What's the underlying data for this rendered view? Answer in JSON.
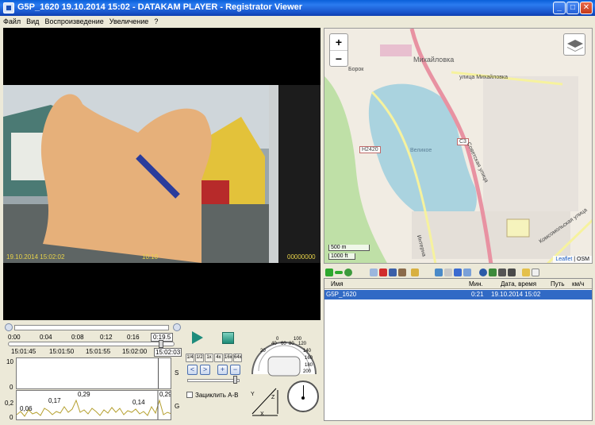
{
  "window": {
    "title": "G5P_1620    19.10.2014 15:02  -  DATAKAM PLAYER - Registrator Viewer"
  },
  "menu": [
    "Файл",
    "Вид",
    "Воспроизведение",
    "Увеличение",
    "?"
  ],
  "video": {
    "osd_left": "19.10.2014 15:02:02",
    "osd_mid": "10.10",
    "osd_right": "00000000"
  },
  "map": {
    "zoom_in": "+",
    "zoom_out": "−",
    "labels": {
      "town": "Михайловка",
      "village": "Борок",
      "street1": "улица Михайловка",
      "road_badge": "Н2420",
      "road_badge2": "С3",
      "lake": "Великое",
      "street2": "Советская улица",
      "street3": "Комсомольская улица",
      "street4": "Интерна"
    },
    "scale_m": "500 m",
    "scale_ft": "1000 ft",
    "attribution_link": "Leaflet",
    "attribution_sep": " | OSM"
  },
  "trips": {
    "columns": {
      "name": "Имя",
      "min": "Мин.",
      "datetime": "Дата, время",
      "path": "Путь",
      "speed": "км/ч"
    },
    "rows": [
      {
        "name": "G5P_1620",
        "min": "0:21",
        "datetime": "19.10.2014 15:02"
      }
    ]
  },
  "timeline": {
    "scale_ticks": [
      "0:00",
      "0:04",
      "0:08",
      "0:12",
      "0:16"
    ],
    "current": "0:19.5",
    "clock_ticks": [
      "15:01:45",
      "15:01:50",
      "15:01:55",
      "15:02:00",
      "15:02:03"
    ],
    "graph_s_ticks": [
      "10",
      "0"
    ],
    "graph_g_ticks": [
      "0,2",
      "0"
    ],
    "graph_s_label": "S",
    "graph_g_label": "G",
    "g_peaks": [
      "0,06",
      "0,17",
      "0,29",
      "0,14",
      "0,29"
    ]
  },
  "controls": {
    "speed_buttons": [
      "1/4",
      "1/2",
      "1x",
      "4x",
      "16x",
      "64x"
    ],
    "loop_label": "Зациклить A-B",
    "speedo_ticks": [
      "0",
      "40",
      "60",
      "80",
      "100",
      "120",
      "20",
      "140",
      "160",
      "180",
      "200"
    ],
    "axis_x": "X",
    "axis_y": "Y",
    "axis_z": "Z"
  },
  "colors": {
    "title_bar": "#1753c9",
    "selection": "#316ac5"
  }
}
